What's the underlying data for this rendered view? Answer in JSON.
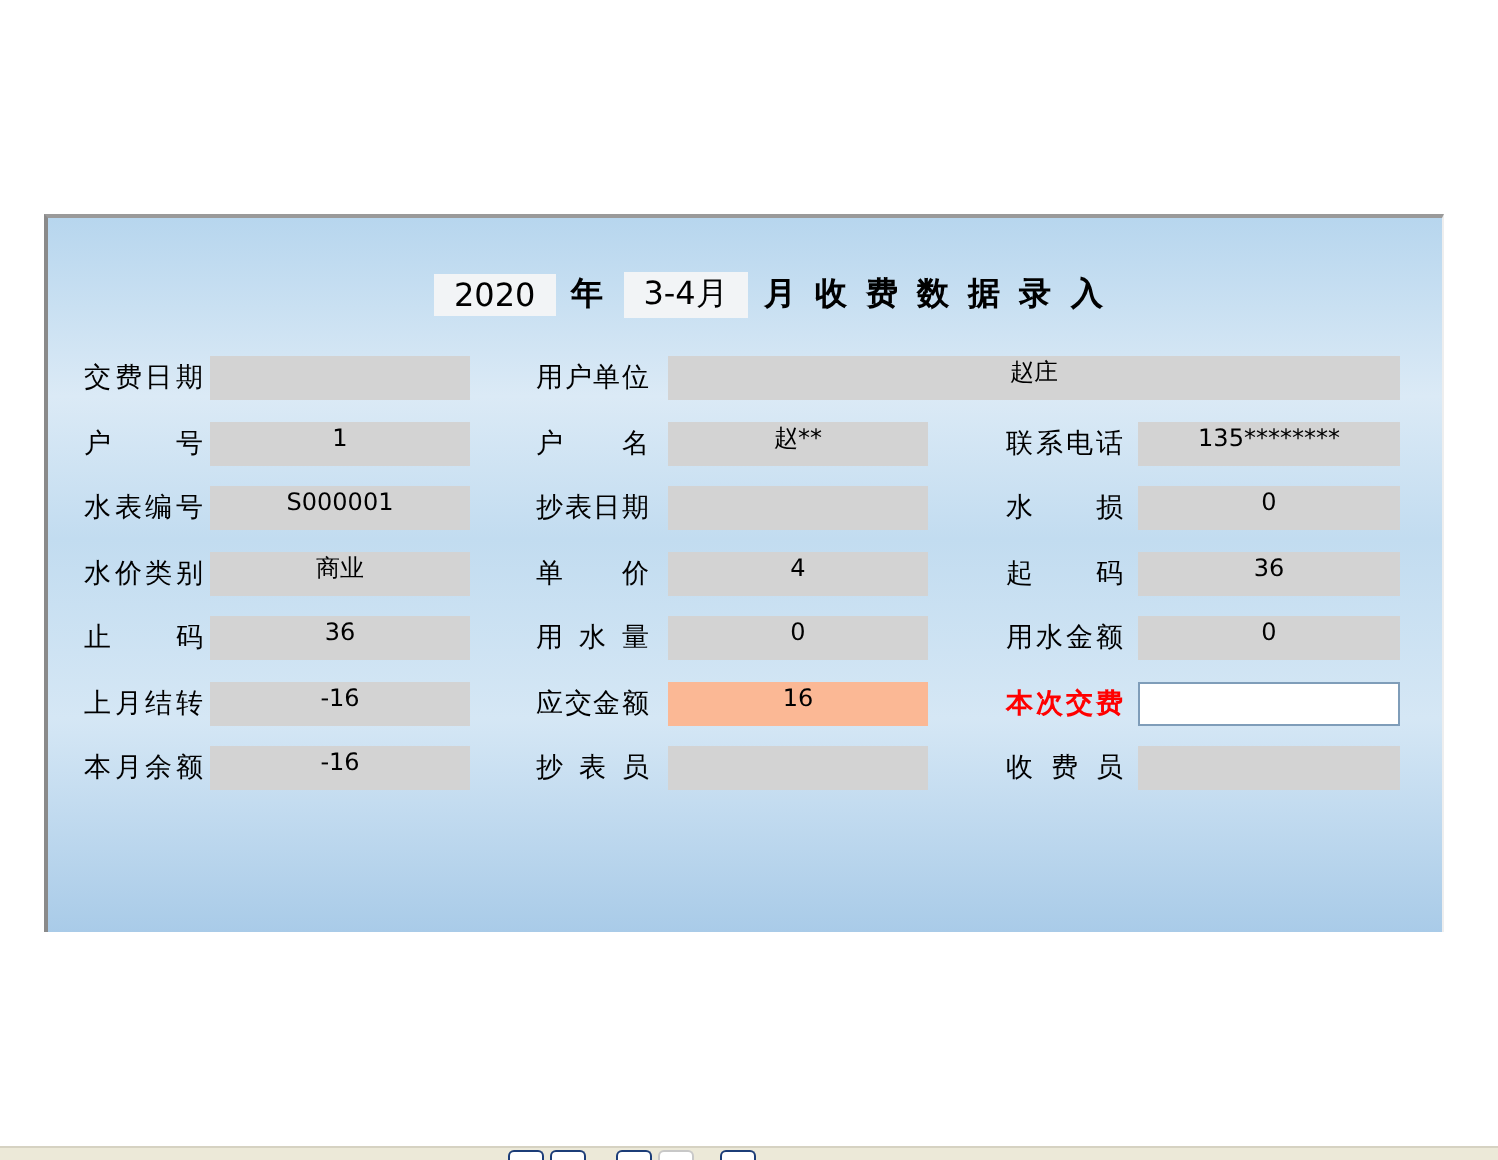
{
  "title": {
    "year": "2020",
    "year_unit": "年",
    "period": "3-4月",
    "rest": "月 收 费 数 据 录 入"
  },
  "rows": [
    [
      {
        "label": "交费日期",
        "field": {
          "kind": "plain"
        }
      },
      {
        "label": "用户单位",
        "field": {
          "kind": "plain",
          "wide": true,
          "value": "赵庄"
        }
      }
    ],
    [
      {
        "label": "户 号",
        "field": {
          "kind": "plain",
          "value": "1"
        }
      },
      {
        "label": "户 名",
        "field": {
          "kind": "plain",
          "value": "赵**"
        }
      },
      {
        "label": "联系电话",
        "field": {
          "kind": "plain",
          "value": "135********"
        }
      }
    ],
    [
      {
        "label": "水表编号",
        "field": {
          "kind": "plain",
          "value": "S000001"
        }
      },
      {
        "label": "抄表日期",
        "field": {
          "kind": "plain"
        }
      },
      {
        "label": "水 损",
        "field": {
          "kind": "plain",
          "value": "0"
        }
      }
    ],
    [
      {
        "label": "水价类别",
        "field": {
          "kind": "plain",
          "value": "商业"
        }
      },
      {
        "label": "单 价",
        "field": {
          "kind": "plain",
          "value": "4"
        }
      },
      {
        "label": "起 码",
        "field": {
          "kind": "plain",
          "value": "36"
        }
      }
    ],
    [
      {
        "label": "止 码",
        "field": {
          "kind": "plain",
          "value": "36"
        }
      },
      {
        "label": "用 水 量",
        "field": {
          "kind": "plain",
          "value": "0"
        }
      },
      {
        "label": "用水金额",
        "field": {
          "kind": "plain",
          "value": "0"
        }
      }
    ],
    [
      {
        "label": "上月结转",
        "field": {
          "kind": "plain",
          "value": "-16"
        }
      },
      {
        "label": "应交金额",
        "field": {
          "kind": "highlight",
          "value": "16"
        }
      },
      {
        "label": "本次交费",
        "emphasis": true,
        "field": {
          "kind": "input"
        }
      }
    ],
    [
      {
        "label": "本月余额",
        "field": {
          "kind": "plain",
          "value": "-16"
        }
      },
      {
        "label": "抄 表 员",
        "field": {
          "kind": "plain"
        }
      },
      {
        "label": "收 费 员",
        "field": {
          "kind": "plain"
        }
      }
    ]
  ]
}
